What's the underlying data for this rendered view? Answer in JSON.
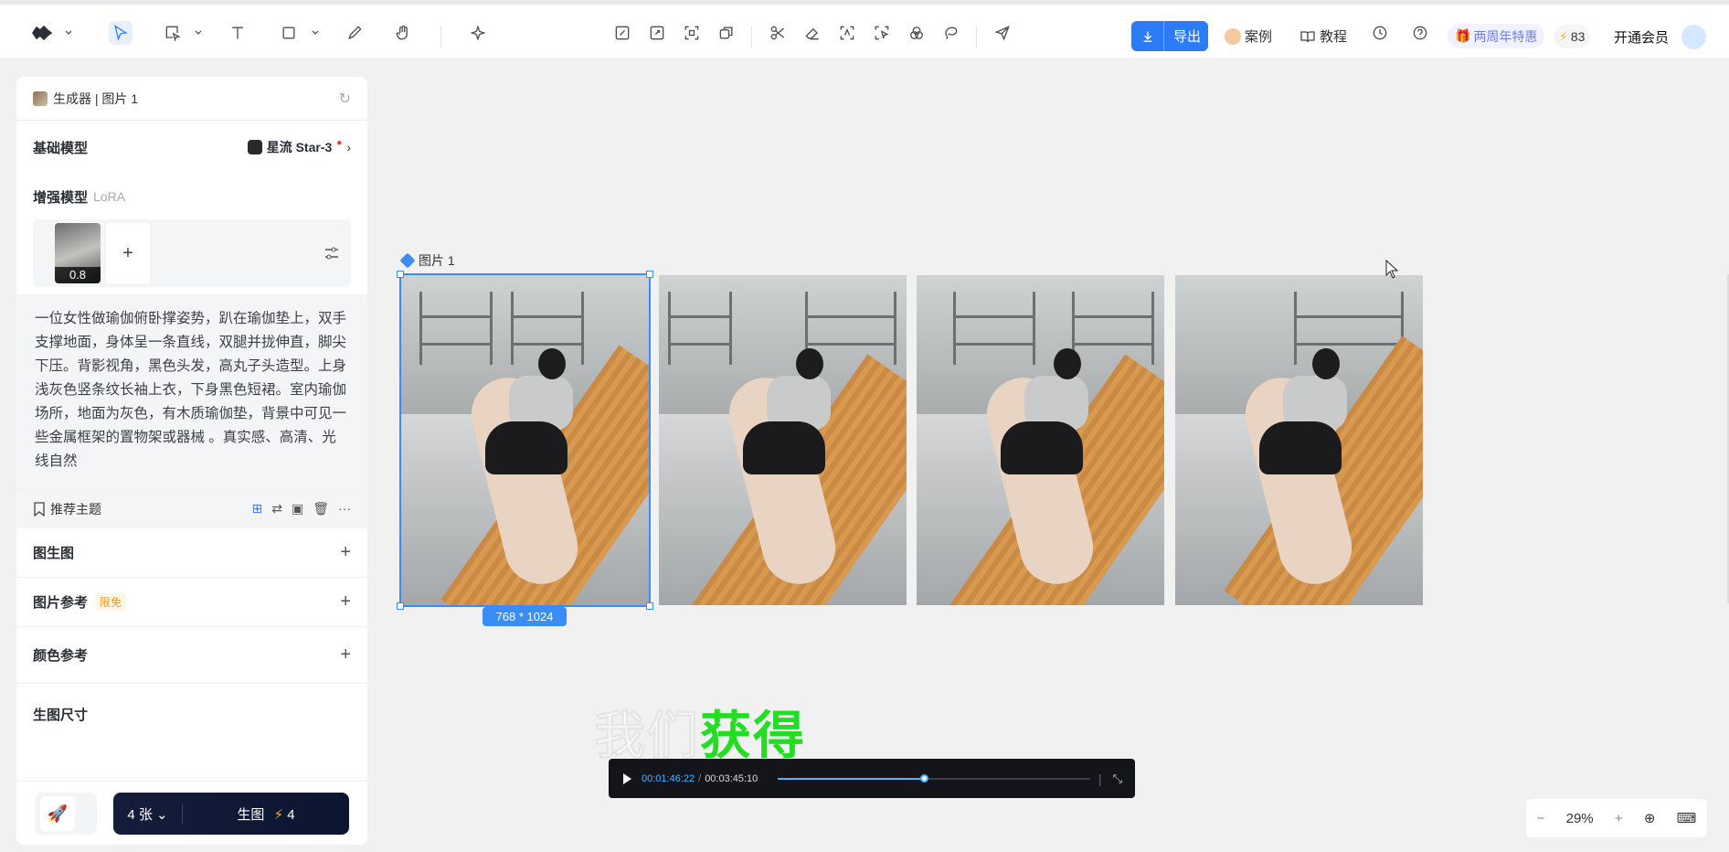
{
  "toolbar": {
    "export_label": "导出",
    "cases_label": "案例",
    "tutorial_label": "教程",
    "promo_label": "两周年特惠",
    "credits": "83",
    "member_label": "开通会员"
  },
  "panel": {
    "header": "生成器 | 图片 1",
    "base_model_label": "基础模型",
    "base_model_value": "星流 Star-3",
    "enhance_label": "增强模型",
    "enhance_sub": "LoRA",
    "lora_weight": "0.8",
    "prompt": "一位女性做瑜伽俯卧撑姿势，趴在瑜伽垫上，双手支撑地面，身体呈一条直线，双腿并拢伸直，脚尖下压。背影视角，黑色头发，高丸子头造型。上身浅灰色竖条纹长袖上衣，下身黑色短裙。室内瑜伽场所，地面为灰色，有木质瑜伽垫，背景中可见一些金属框架的置物架或器械 。真实感、高清、光线自然",
    "recommend_label": "推荐主题",
    "img2img_label": "图生图",
    "img_ref_label": "图片参考",
    "img_ref_badge": "限免",
    "color_ref_label": "颜色参考",
    "size_label": "生图尺寸",
    "count_label": "4 张",
    "generate_label": "生图",
    "generate_cost": "4"
  },
  "canvas": {
    "group_label": "图片 1",
    "dimension_label": "768 * 1024",
    "subtitle_white": "我们",
    "subtitle_green": "获得"
  },
  "player": {
    "current_time": "00:01:46:22",
    "separator": "/",
    "total_time": "00:03:45:10",
    "progress": 0.47
  },
  "zoom": {
    "minus": "−",
    "level": "29%",
    "plus": "+"
  }
}
